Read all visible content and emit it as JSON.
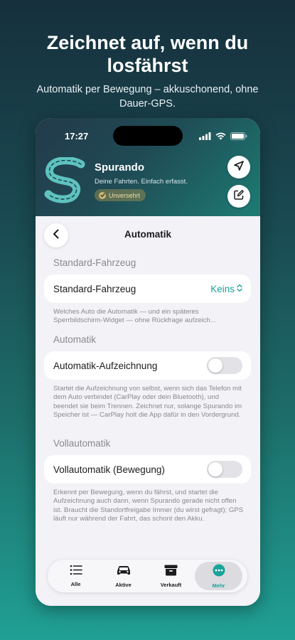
{
  "promo": {
    "title": "Zeichnet auf, wenn du losfährst",
    "subtitle": "Automatik per Bewegung – akkuschonend, ohne Dauer-GPS."
  },
  "status_bar": {
    "time": "17:27"
  },
  "app": {
    "name": "Spurando",
    "tagline": "Deine Fahrten. Einfach erfasst.",
    "badge": "Unversehrt"
  },
  "nav": {
    "title": "Automatik"
  },
  "sections": [
    {
      "header": "Standard-Fahrzeug",
      "row_label": "Standard-Fahrzeug",
      "row_value": "Keins",
      "footnote": "Welches Auto die Automatik — und ein späteres Sperrbildschirm-Widget — ohne Rückfrage aufzeich..."
    },
    {
      "header": "Automatik",
      "row_label": "Automatik-Aufzeichnung",
      "toggle_on": false,
      "footnote": "Startet die Aufzeichnung von selbst, wenn sich das Telefon mit dem Auto verbindet (CarPlay oder dein Bluetooth), und beendet sie beim Trennen. Zeichnet nur, solange Spurando im Speicher ist — CarPlay holt die App dafür in den Vordergrund."
    },
    {
      "header": "Vollautomatik",
      "row_label": "Vollautomatik (Bewegung)",
      "toggle_on": false,
      "footnote": "Erkennt per Bewegung, wenn du fährst, und startet die Aufzeichnung auch dann, wenn Spurando gerade nicht offen ist. Braucht die Standortfreigabe Immer (du wirst gefragt); GPS läuft nur während der Fahrt, das schont den Akku."
    }
  ],
  "tabs": [
    {
      "label": "Alle",
      "icon": "list-icon"
    },
    {
      "label": "Aktive",
      "icon": "car-icon"
    },
    {
      "label": "Verkauft",
      "icon": "archive-box-icon"
    },
    {
      "label": "Mehr",
      "icon": "more-circle-icon",
      "active": true
    }
  ],
  "colors": {
    "accent": "#1aa39a",
    "hero_start": "#233a4a",
    "hero_end": "#1e7c74",
    "badge_text": "#e9dca8"
  }
}
